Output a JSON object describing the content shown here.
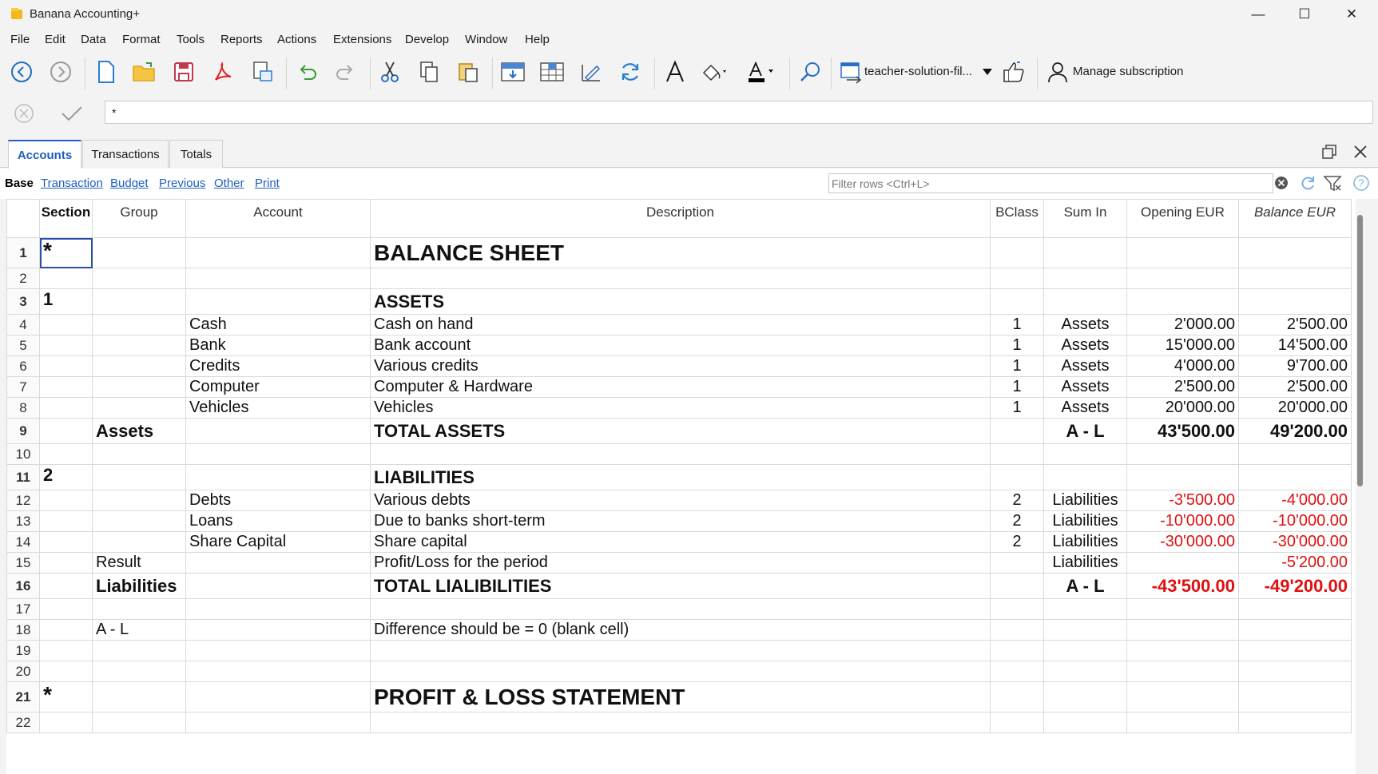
{
  "window": {
    "title": "Banana Accounting+"
  },
  "menu": [
    "File",
    "Edit",
    "Data",
    "Format",
    "Tools",
    "Reports",
    "Actions",
    "Extensions",
    "Develop",
    "Window",
    "Help"
  ],
  "toolbar": {
    "file_label": "teacher-solution-fil...",
    "subscription_label": "Manage subscription"
  },
  "formula": {
    "value": "*"
  },
  "tabs": [
    "Accounts",
    "Transactions",
    "Totals"
  ],
  "views": [
    "Base",
    "Transaction",
    "Budget",
    "Previous",
    "Other",
    "Print"
  ],
  "filter": {
    "placeholder": "Filter rows <Ctrl+L>"
  },
  "columns": [
    "Section",
    "Group",
    "Account",
    "Description",
    "BClass",
    "Sum In",
    "Opening EUR",
    "Balance EUR"
  ],
  "rows": [
    {
      "n": "1",
      "section": "*",
      "group": "",
      "account": "",
      "description": "BALANCE SHEET",
      "bclass": "",
      "sumin": "",
      "opening": "",
      "balance": ""
    },
    {
      "n": "2",
      "section": "",
      "group": "",
      "account": "",
      "description": "",
      "bclass": "",
      "sumin": "",
      "opening": "",
      "balance": ""
    },
    {
      "n": "3",
      "section": "1",
      "group": "",
      "account": "",
      "description": "ASSETS",
      "bclass": "",
      "sumin": "",
      "opening": "",
      "balance": ""
    },
    {
      "n": "4",
      "section": "",
      "group": "",
      "account": "Cash",
      "description": "Cash on hand",
      "bclass": "1",
      "sumin": "Assets",
      "opening": "2'000.00",
      "balance": "2'500.00"
    },
    {
      "n": "5",
      "section": "",
      "group": "",
      "account": "Bank",
      "description": "Bank account",
      "bclass": "1",
      "sumin": "Assets",
      "opening": "15'000.00",
      "balance": "14'500.00"
    },
    {
      "n": "6",
      "section": "",
      "group": "",
      "account": "Credits",
      "description": "Various credits",
      "bclass": "1",
      "sumin": "Assets",
      "opening": "4'000.00",
      "balance": "9'700.00"
    },
    {
      "n": "7",
      "section": "",
      "group": "",
      "account": "Computer",
      "description": "Computer & Hardware",
      "bclass": "1",
      "sumin": "Assets",
      "opening": "2'500.00",
      "balance": "2'500.00"
    },
    {
      "n": "8",
      "section": "",
      "group": "",
      "account": "Vehicles",
      "description": "Vehicles",
      "bclass": "1",
      "sumin": "Assets",
      "opening": "20'000.00",
      "balance": "20'000.00"
    },
    {
      "n": "9",
      "section": "",
      "group": "Assets",
      "account": "",
      "description": "TOTAL ASSETS",
      "bclass": "",
      "sumin": "A - L",
      "opening": "43'500.00",
      "balance": "49'200.00"
    },
    {
      "n": "10",
      "section": "",
      "group": "",
      "account": "",
      "description": "",
      "bclass": "",
      "sumin": "",
      "opening": "",
      "balance": ""
    },
    {
      "n": "11",
      "section": "2",
      "group": "",
      "account": "",
      "description": "LIABILITIES",
      "bclass": "",
      "sumin": "",
      "opening": "",
      "balance": ""
    },
    {
      "n": "12",
      "section": "",
      "group": "",
      "account": "Debts",
      "description": "Various debts",
      "bclass": "2",
      "sumin": "Liabilities",
      "opening": "-3'500.00",
      "balance": "-4'000.00"
    },
    {
      "n": "13",
      "section": "",
      "group": "",
      "account": "Loans",
      "description": "Due to banks short-term",
      "bclass": "2",
      "sumin": "Liabilities",
      "opening": "-10'000.00",
      "balance": "-10'000.00"
    },
    {
      "n": "14",
      "section": "",
      "group": "",
      "account": "Share Capital",
      "description": "Share capital",
      "bclass": "2",
      "sumin": "Liabilities",
      "opening": "-30'000.00",
      "balance": "-30'000.00"
    },
    {
      "n": "15",
      "section": "",
      "group": "Result",
      "account": "",
      "description": "Profit/Loss for the period",
      "bclass": "",
      "sumin": "Liabilities",
      "opening": "",
      "balance": "-5'200.00"
    },
    {
      "n": "16",
      "section": "",
      "group": "Liabilities",
      "account": "",
      "description": "TOTAL LIALIBILITIES",
      "bclass": "",
      "sumin": "A - L",
      "opening": "-43'500.00",
      "balance": "-49'200.00"
    },
    {
      "n": "17",
      "section": "",
      "group": "",
      "account": "",
      "description": "",
      "bclass": "",
      "sumin": "",
      "opening": "",
      "balance": ""
    },
    {
      "n": "18",
      "section": "",
      "group": "A - L",
      "account": "",
      "description": "Difference should be = 0 (blank cell)",
      "bclass": "",
      "sumin": "",
      "opening": "",
      "balance": ""
    },
    {
      "n": "19",
      "section": "",
      "group": "",
      "account": "",
      "description": "",
      "bclass": "",
      "sumin": "",
      "opening": "",
      "balance": ""
    },
    {
      "n": "20",
      "section": "",
      "group": "",
      "account": "",
      "description": "",
      "bclass": "",
      "sumin": "",
      "opening": "",
      "balance": ""
    },
    {
      "n": "21",
      "section": "*",
      "group": "",
      "account": "",
      "description": "PROFIT & LOSS STATEMENT",
      "bclass": "",
      "sumin": "",
      "opening": "",
      "balance": ""
    },
    {
      "n": "22",
      "section": "",
      "group": "",
      "account": "",
      "description": "",
      "bclass": "",
      "sumin": "",
      "opening": "",
      "balance": ""
    }
  ],
  "colors": {
    "accent": "#1f5fbf",
    "negative": "#e01010"
  }
}
